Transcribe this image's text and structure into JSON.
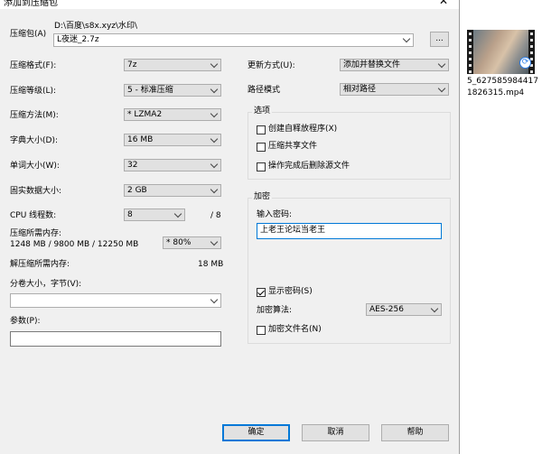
{
  "window": {
    "title": "添加到压缩包",
    "close_glyph": "✕"
  },
  "archive": {
    "label": "压缩包(A)",
    "path": "D:\\百度\\s8x.xyz\\水印\\",
    "filename": "L夜迷_2.7z",
    "browse_label": "..."
  },
  "format": {
    "label": "压缩格式(F):",
    "value": "7z"
  },
  "level": {
    "label": "压缩等级(L):",
    "value": "5 - 标准压缩"
  },
  "method": {
    "label": "压缩方法(M):",
    "value": "* LZMA2"
  },
  "dict": {
    "label": "字典大小(D):",
    "value": "16 MB"
  },
  "word": {
    "label": "单词大小(W):",
    "value": "32"
  },
  "solid": {
    "label": "固实数据大小:",
    "value": "2 GB"
  },
  "threads": {
    "label": "CPU 线程数:",
    "value": "8",
    "total": "/ 8"
  },
  "memory": {
    "label": "压缩所需内存:",
    "detail": "1248 MB / 9800 MB / 12250 MB",
    "percent": "* 80%"
  },
  "decomp_memory": {
    "label": "解压缩所需内存:",
    "value": "18 MB"
  },
  "volume": {
    "label": "分卷大小，字节(V):",
    "value": ""
  },
  "params": {
    "label": "参数(P):",
    "value": ""
  },
  "update": {
    "label": "更新方式(U):",
    "value": "添加并替换文件"
  },
  "pathmode": {
    "label": "路径模式",
    "value": "相对路径"
  },
  "options": {
    "title": "选项",
    "sfx": {
      "label": "创建自释放程序(X)",
      "checked": false
    },
    "shared": {
      "label": "压缩共享文件",
      "checked": false
    },
    "delete": {
      "label": "操作完成后删除源文件",
      "checked": false
    }
  },
  "encryption": {
    "title": "加密",
    "password_label": "输入密码:",
    "password_value": "上老王论坛当老王",
    "show_password": {
      "label": "显示密码(S)",
      "checked": true
    },
    "method_label": "加密算法:",
    "method_value": "AES-256",
    "encrypt_names": {
      "label": "加密文件名(N)",
      "checked": false
    }
  },
  "buttons": {
    "ok": "确定",
    "cancel": "取消",
    "help": "帮助"
  },
  "desktop_file": {
    "name": "5_6275859844171826315.mp4",
    "icon": "video-file-icon",
    "badge_icon": "sync-icon"
  },
  "colors": {
    "dialog_bg": "#f0f0f0",
    "accent": "#0078d7",
    "sync_badge": "#2b7de9"
  }
}
